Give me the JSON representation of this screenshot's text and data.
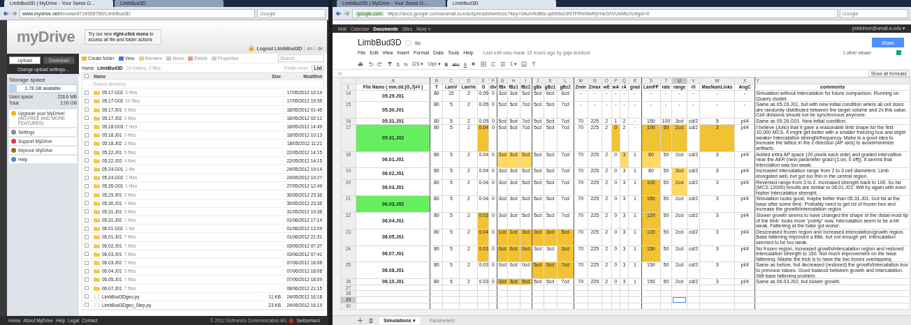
{
  "left_browser": {
    "tabs": [
      {
        "label": "LimbBud3D | MyDrive - Your Swiss O...",
        "selected": true
      },
      {
        "label": "LimbBud3D",
        "selected": false
      }
    ],
    "domain": "www.mydrive.net",
    "address": "/browse#714565780/LimbBud3D",
    "search_placeholder": "Google"
  },
  "mydrive": {
    "logo": "myDrive",
    "promo": "Try our new **right-click menu** to access all file and folder actions",
    "logout": "Logout LimbBud3D",
    "languages": [
      "en",
      "de"
    ],
    "upload": {
      "label": "Upload",
      "disabled": false
    },
    "download": {
      "label": "Download",
      "disabled": true
    },
    "upload_settings": "Change upload settings...",
    "storage": {
      "title": "Storage space",
      "available": "1.78 GB available",
      "level": 0.11,
      "used_label": "Used space",
      "used": "226.6 MB",
      "total_label": "Total",
      "total": "2.00 GB"
    },
    "menu": [
      {
        "kind": "upgrade",
        "label": "Upgrade your MyDrive!",
        "sub": "(AD-FREE AND MORE FEATURES)"
      },
      {
        "kind": "settings",
        "label": "Settings"
      },
      {
        "kind": "support",
        "label": "Support MyDrive"
      },
      {
        "kind": "improve",
        "label": "Improve MyDrive"
      },
      {
        "kind": "help",
        "label": "Help"
      }
    ],
    "toolbar": [
      {
        "kind": "create",
        "label": "Create folder",
        "disabled": false
      },
      {
        "kind": "view",
        "label": "View",
        "disabled": false
      },
      {
        "kind": "rename",
        "label": "Rename",
        "disabled": true
      },
      {
        "kind": "move",
        "label": "Move",
        "disabled": true
      },
      {
        "kind": "delete",
        "label": "Delete",
        "disabled": true
      },
      {
        "kind": "properties",
        "label": "Properties",
        "disabled": true
      }
    ],
    "search_placeholder": "Search...",
    "breadcrumb": {
      "home": "Home",
      "folder": "LimbBud3D",
      "summary": "24 folders, 2 files",
      "view_label": "Folder view:",
      "view": "List"
    },
    "columns": {
      "name": "Name",
      "size": "Size",
      "modified": "Modified"
    },
    "select_all": {
      "checked": false
    },
    "parent": "Parent directory",
    "items": [
      {
        "kind": "folder",
        "name": "05.17.G01",
        "count": "3 files",
        "modified": "17/05/2012 19:14",
        "checked": false
      },
      {
        "kind": "folder",
        "name": "05.17.G02",
        "count": "10 files",
        "modified": "17/05/2012 19:35",
        "checked": false
      },
      {
        "kind": "folder",
        "name": "05.17.J01",
        "count": "5 files",
        "modified": "18/05/2012 01:45",
        "checked": false
      },
      {
        "kind": "folder",
        "name": "05.17.J02",
        "count": "3 files",
        "modified": "18/05/2012 02:12",
        "checked": false
      },
      {
        "kind": "folder",
        "name": "05.18.G03",
        "count": "2 files",
        "modified": "18/05/2012 14:49",
        "checked": false
      },
      {
        "kind": "folder",
        "name": "05.18.J01",
        "count": "3 files",
        "modified": "18/05/2012 10:13",
        "checked": false
      },
      {
        "kind": "folder",
        "name": "05.18.J02",
        "count": "3 files",
        "modified": "18/05/2012 11:21",
        "checked": false
      },
      {
        "kind": "folder",
        "name": "05.22.J01",
        "count": "5 files",
        "modified": "22/05/2012 14:15",
        "checked": false
      },
      {
        "kind": "folder",
        "name": "05.22.J02",
        "count": "4 files",
        "modified": "22/05/2012 14:15",
        "checked": false
      },
      {
        "kind": "folder",
        "name": "05.24.G01",
        "count": "1 file",
        "modified": "24/05/2012 19:14",
        "checked": false
      },
      {
        "kind": "folder",
        "name": "05.24.G02",
        "count": "2 files",
        "modified": "24/05/2012 19:27",
        "checked": false
      },
      {
        "kind": "folder",
        "name": "05.26.G01",
        "count": "1 files",
        "modified": "27/05/2012 12:49",
        "checked": false
      },
      {
        "kind": "folder",
        "name": "05.29.J01",
        "count": "2 files",
        "modified": "30/05/2012 23:36",
        "checked": false
      },
      {
        "kind": "folder",
        "name": "05.30.J01",
        "count": "7 files",
        "modified": "30/05/2012 23:35",
        "checked": false
      },
      {
        "kind": "folder",
        "name": "05.31.J01",
        "count": "9 files",
        "modified": "31/05/2012 19:38",
        "checked": false
      },
      {
        "kind": "folder",
        "name": "05.31.J02",
        "count": "7 files",
        "modified": "01/06/2012 17:14",
        "checked": false
      },
      {
        "kind": "folder",
        "name": "06.01.G01",
        "count": "1 file",
        "modified": "01/06/2012 13:09",
        "checked": false
      },
      {
        "kind": "folder",
        "name": "06.01.J01",
        "count": "7 files",
        "modified": "01/06/2012 21:31",
        "checked": false
      },
      {
        "kind": "folder",
        "name": "06.02.J01",
        "count": "7 files",
        "modified": "03/06/2012 07:37",
        "checked": false
      },
      {
        "kind": "folder",
        "name": "06.03.J01",
        "count": "7 files",
        "modified": "03/06/2012 07:41",
        "checked": false
      },
      {
        "kind": "folder",
        "name": "06.03.J02",
        "count": "7 files",
        "modified": "07/06/2012 18:08",
        "checked": false
      },
      {
        "kind": "folder",
        "name": "06.04.J01",
        "count": "3 files",
        "modified": "07/06/2012 18:08",
        "checked": false
      },
      {
        "kind": "folder",
        "name": "06.05.J01",
        "count": "7 files",
        "modified": "07/06/2012 18:09",
        "checked": false
      },
      {
        "kind": "folder",
        "name": "06.07.J01",
        "count": "7 files",
        "modified": "08/06/2012 21:15",
        "checked": false
      },
      {
        "kind": "file",
        "name": "LimbBud3Dgeo.py",
        "size": "11 KB",
        "modified": "24/05/2012 16:18",
        "checked": false
      },
      {
        "kind": "file",
        "name": "LimbBud3Dgeo_Step.py",
        "size": "23 KB",
        "modified": "24/05/2012 16:19",
        "checked": false
      }
    ],
    "footer_links": [
      "Home",
      "About MyDrive",
      "Help",
      "Legal",
      "Contact"
    ],
    "copyright": "© 2012 Softronics Communication AG",
    "country": "Switzerland"
  },
  "right_browser": {
    "tabs": [
      {
        "label": "LimbBud3D | MyDrive - Your Swiss O...",
        "selected": false
      },
      {
        "label": "LimbBud3D",
        "selected": true
      }
    ],
    "domain": "google.com",
    "address": "https://docs.google.com/a/umail.iu.edu/spreadsheet/ccc?key=0AoiVkdBts-qd0Ma2dNTFRN0lwRjVneGhVUkMtcXc#gid=0",
    "search_placeholder": "Google"
  },
  "google_bar": {
    "links": [
      {
        "label": "Mail",
        "selected": false
      },
      {
        "label": "Calendar",
        "selected": false
      },
      {
        "label": "Documents",
        "selected": true
      },
      {
        "label": "Sites",
        "selected": false
      },
      {
        "label": "More »",
        "selected": false
      }
    ],
    "user": "jmbelmon@umail.iu.edu ▾"
  },
  "document": {
    "title": "LimbBud3D",
    "share": "Share",
    "menu": [
      "File",
      "Edit",
      "View",
      "Insert",
      "Format",
      "Data",
      "Tools",
      "Help"
    ],
    "last_edit": "Last edit was made 15 hours ago by gaja lesnicar",
    "viewers": "1 other viewer",
    "toolbar": {
      "currency": "$",
      "percent": "%",
      "number_format": "123 ▾",
      "font_size": "10pt ▾",
      "bold": "B",
      "strike": "abc",
      "text_color": "A",
      "sum": "Σ ▾"
    },
    "fx": "fx",
    "show_formulas": "Show all formulas"
  },
  "sheet": {
    "header_row": "1",
    "columns": [
      {
        "letter": "A",
        "name": "File Name ( mm.dd.(G,J)## )",
        "selected": false
      },
      {
        "letter": "B",
        "name": "T",
        "selected": false
      },
      {
        "letter": "C",
        "name": "LamV",
        "selected": false
      },
      {
        "letter": "D",
        "name": "LamVe",
        "selected": false
      },
      {
        "letter": "E",
        "name": "G",
        "selected": false
      },
      {
        "letter": "F",
        "name": "div",
        "selected": false
      },
      {
        "letter": "G",
        "name": "fBx",
        "selected": false
      },
      {
        "letter": "H",
        "name": "fBz1",
        "selected": false
      },
      {
        "letter": "I",
        "name": "fBz2",
        "selected": false
      },
      {
        "letter": "J",
        "name": "gBx",
        "selected": false
      },
      {
        "letter": "K",
        "name": "gBz1",
        "selected": false
      },
      {
        "letter": "L",
        "name": "gBz2",
        "selected": false
      },
      {
        "letter": "M",
        "name": "Zmin",
        "selected": false
      },
      {
        "letter": "N",
        "name": "Zmax",
        "selected": false
      },
      {
        "letter": "O",
        "name": "wE",
        "selected": false
      },
      {
        "letter": "P",
        "name": "wA",
        "selected": false
      },
      {
        "letter": "Q",
        "name": "rA",
        "selected": false
      },
      {
        "letter": "R",
        "name": "grad",
        "selected": false
      },
      {
        "letter": "S",
        "name": "LamFP",
        "selected": false
      },
      {
        "letter": "T",
        "name": "rate",
        "selected": false
      },
      {
        "letter": "U",
        "name": "range",
        "selected": true
      },
      {
        "letter": "V",
        "name": "r0",
        "selected": false
      },
      {
        "letter": "W",
        "name": "MaxNumLinks",
        "selected": false
      },
      {
        "letter": "X",
        "name": "AngC",
        "selected": false
      },
      {
        "letter": "Y",
        "name": "comments",
        "selected": false
      }
    ],
    "rows": [
      {
        "number": "14",
        "selected": false,
        "cells": [
          {
            "text": "05.29.J01"
          },
          {
            "text": "80"
          },
          {
            "text": "15"
          },
          {
            "text": "2"
          },
          {
            "text": "0.05"
          },
          {
            "text": "0"
          },
          {
            "text": "3cd"
          },
          {
            "text": "3cd"
          },
          {
            "text": "5cd"
          },
          {
            "text": "5cd"
          },
          {
            "text": "6cd"
          },
          {
            "text": "6cd"
          },
          {
            "text": "-"
          },
          {
            "text": "-"
          },
          {
            "text": "-"
          },
          {
            "text": "-"
          },
          {
            "text": "-"
          },
          {
            "text": "-"
          },
          {
            "text": "-"
          },
          {
            "text": "-"
          },
          {
            "text": "-"
          },
          {
            "text": "-"
          },
          {
            "text": "-"
          },
          {
            "text": "-"
          },
          {
            "text": "Simulation without intercalation for future comparison. Running on Quarry cluster."
          }
        ]
      },
      {
        "number": "15",
        "selected": false,
        "cells": [
          {
            "text": "05.30.J01"
          },
          {
            "text": "80"
          },
          {
            "text": "5"
          },
          {
            "text": "2"
          },
          {
            "text": "0.05"
          },
          {
            "text": "0"
          },
          {
            "text": "5cd"
          },
          {
            "text": "5cd"
          },
          {
            "text": "7cd"
          },
          {
            "text": "5cd"
          },
          {
            "text": "5cd"
          },
          {
            "text": "7cd"
          },
          {
            "text": "-"
          },
          {
            "text": "-"
          },
          {
            "text": "-"
          },
          {
            "text": "-"
          },
          {
            "text": "-"
          },
          {
            "text": "-"
          },
          {
            "text": "-"
          },
          {
            "text": "-"
          },
          {
            "text": "-"
          },
          {
            "text": "-"
          },
          {
            "text": "-"
          },
          {
            "text": "-"
          },
          {
            "text": "Same as 05.29.J01, but with new initial condition where all cell sizes are randomly distributed between the target volume and 2x this value. Cell divisions should not be synchronous anymore."
          }
        ]
      },
      {
        "number": "16",
        "selected": false,
        "cells": [
          {
            "text": "05.31.J01"
          },
          {
            "text": "80"
          },
          {
            "text": "5"
          },
          {
            "text": "2"
          },
          {
            "text": "0.05"
          },
          {
            "text": "0"
          },
          {
            "text": "5cd"
          },
          {
            "text": "5cd"
          },
          {
            "text": "7cd"
          },
          {
            "text": "5cd"
          },
          {
            "text": "5cd"
          },
          {
            "text": "7cd"
          },
          {
            "text": "70"
          },
          {
            "text": "225"
          },
          {
            "text": "2"
          },
          {
            "text": "1"
          },
          {
            "text": "2"
          },
          {
            "text": "-"
          },
          {
            "text": "150"
          },
          {
            "text": "100"
          },
          {
            "text": "3cd"
          },
          {
            "text": "cd/2"
          },
          {
            "text": "5"
          },
          {
            "text": "pi/4"
          },
          {
            "text": "Same as 05.26.G01. New initial condition."
          }
        ]
      },
      {
        "number": "17",
        "selected": false,
        "cells": [
          {
            "text": "05.31.J02",
            "color": "#66ee5e"
          },
          {
            "text": "80"
          },
          {
            "text": "5"
          },
          {
            "text": "2"
          },
          {
            "text": "0.04",
            "color": "#f1c232"
          },
          {
            "text": "0"
          },
          {
            "text": "5cd"
          },
          {
            "text": "5cd"
          },
          {
            "text": "7cd"
          },
          {
            "text": "5cd"
          },
          {
            "text": "5cd"
          },
          {
            "text": "7cd"
          },
          {
            "text": "70"
          },
          {
            "text": "225"
          },
          {
            "text": "2"
          },
          {
            "text": "0",
            "color": "#f1c232"
          },
          {
            "text": "2"
          },
          {
            "text": "-"
          },
          {
            "text": "100",
            "color": "#f1c232"
          },
          {
            "text": "50",
            "color": "#f1c232"
          },
          {
            "text": "2cd",
            "color": "#f1c232"
          },
          {
            "text": "cd/2"
          },
          {
            "text": "3",
            "color": "#f1c232"
          },
          {
            "text": "pi/4"
          },
          {
            "text": "I believe (Julio) that it gave a reasonable limb shape for the first 10,000 MCS. It might get better with a smaller freezing box and slight weaker intercalation strenght/frequency. Mabe is a good idea to increase the lattice in the z direction (AP axis) to avoid/minimize artifacts."
          }
        ]
      },
      {
        "number": "18",
        "selected": false,
        "cells": [
          {
            "text": "06.01.J01"
          },
          {
            "text": "80"
          },
          {
            "text": "5"
          },
          {
            "text": "2"
          },
          {
            "text": "0.04"
          },
          {
            "text": "0"
          },
          {
            "text": "3cd",
            "color": "#ffd966"
          },
          {
            "text": "3cd",
            "color": "#ffd966"
          },
          {
            "text": "5cd",
            "color": "#ffd966"
          },
          {
            "text": "5cd"
          },
          {
            "text": "5cd"
          },
          {
            "text": "7cd"
          },
          {
            "text": "70"
          },
          {
            "text": "225"
          },
          {
            "text": "2"
          },
          {
            "text": "0"
          },
          {
            "text": "3",
            "color": "#ffd966"
          },
          {
            "text": "1"
          },
          {
            "text": "80",
            "color": "#ffd966"
          },
          {
            "text": "50"
          },
          {
            "text": "2cd"
          },
          {
            "text": "cd/2"
          },
          {
            "text": "3"
          },
          {
            "text": "pi/4"
          },
          {
            "text": "Added extra AP space (20 pixels each side) and graded intercaltion near the AER (new parameter grad={1:on, 0 off}). It seems that interclation was too weak."
          }
        ]
      },
      {
        "number": "19",
        "selected": false,
        "cells": [
          {
            "text": "06.02.J01"
          },
          {
            "text": "80"
          },
          {
            "text": "5"
          },
          {
            "text": "2"
          },
          {
            "text": "0.04"
          },
          {
            "text": "0"
          },
          {
            "text": "3cd"
          },
          {
            "text": "3cd"
          },
          {
            "text": "5cd"
          },
          {
            "text": "5cd"
          },
          {
            "text": "5cd"
          },
          {
            "text": "7cd"
          },
          {
            "text": "70"
          },
          {
            "text": "225"
          },
          {
            "text": "2"
          },
          {
            "text": "0"
          },
          {
            "text": "3"
          },
          {
            "text": "1"
          },
          {
            "text": "80"
          },
          {
            "text": "50"
          },
          {
            "text": "3cd",
            "color": "#ffd966"
          },
          {
            "text": "cd/2"
          },
          {
            "text": "3"
          },
          {
            "text": "pi/4"
          },
          {
            "text": "Increased intercalation range from 2 to 3 cell diameters. Limb elongated well, but got too thin in the central region."
          }
        ]
      },
      {
        "number": "20",
        "selected": false,
        "cells": [
          {
            "text": "06.03.J01"
          },
          {
            "text": "80"
          },
          {
            "text": "5"
          },
          {
            "text": "2"
          },
          {
            "text": "0.04"
          },
          {
            "text": "0"
          },
          {
            "text": "3cd"
          },
          {
            "text": "3cd"
          },
          {
            "text": "5cd"
          },
          {
            "text": "5cd"
          },
          {
            "text": "5cd"
          },
          {
            "text": "7cd"
          },
          {
            "text": "70"
          },
          {
            "text": "225"
          },
          {
            "text": "2"
          },
          {
            "text": "0"
          },
          {
            "text": "3"
          },
          {
            "text": "1"
          },
          {
            "text": "100",
            "color": "#f1c232"
          },
          {
            "text": "50"
          },
          {
            "text": "2cd",
            "color": "#ffd966"
          },
          {
            "text": "cd/2"
          },
          {
            "text": "3"
          },
          {
            "text": "pi/4"
          },
          {
            "text": "Reversed range from 3 to 2. Increased strength back to 100. So far (MCS 12000) results are similar to 06.01.J01. Will try again with even higher intercalation strenght."
          }
        ]
      },
      {
        "number": "21",
        "selected": false,
        "cells": [
          {
            "text": "06.03.J02",
            "color": "#66ee5e"
          },
          {
            "text": "80"
          },
          {
            "text": "5"
          },
          {
            "text": "2"
          },
          {
            "text": "0.04"
          },
          {
            "text": "0"
          },
          {
            "text": "3cd"
          },
          {
            "text": "3cd"
          },
          {
            "text": "5cd"
          },
          {
            "text": "5cd"
          },
          {
            "text": "5cd"
          },
          {
            "text": "7cd"
          },
          {
            "text": "70"
          },
          {
            "text": "225"
          },
          {
            "text": "2"
          },
          {
            "text": "0"
          },
          {
            "text": "3"
          },
          {
            "text": "1"
          },
          {
            "text": "150",
            "color": "#f1c232"
          },
          {
            "text": "50"
          },
          {
            "text": "2cd"
          },
          {
            "text": "cd/2"
          },
          {
            "text": "3"
          },
          {
            "text": "pi/4"
          },
          {
            "text": "Simulation looks good, maybe better than 05.31.J01. Got fat at the base after some time. Probably need to get rid of frozen box and increase the growth/intercalation region."
          }
        ]
      },
      {
        "number": "22",
        "selected": false,
        "cells": [
          {
            "text": "06.04.J01"
          },
          {
            "text": "80"
          },
          {
            "text": "5"
          },
          {
            "text": "2"
          },
          {
            "text": "0.03",
            "color": "#f1c232"
          },
          {
            "text": "0"
          },
          {
            "text": "3cd"
          },
          {
            "text": "3cd"
          },
          {
            "text": "5cd"
          },
          {
            "text": "5cd"
          },
          {
            "text": "5cd"
          },
          {
            "text": "7cd"
          },
          {
            "text": "70"
          },
          {
            "text": "225"
          },
          {
            "text": "2"
          },
          {
            "text": "0"
          },
          {
            "text": "3"
          },
          {
            "text": "1"
          },
          {
            "text": "120",
            "color": "#f1c232"
          },
          {
            "text": "50"
          },
          {
            "text": "2cd"
          },
          {
            "text": "cd/2"
          },
          {
            "text": "3"
          },
          {
            "text": "pi/4"
          },
          {
            "text": "Slower growth seems to have changed the shape of the distal-most tip of the limb: looks more \"pointy\" now. Intercalation seem to be a bit weak. Fattening at the base got worse."
          }
        ]
      },
      {
        "number": "23",
        "selected": false,
        "cells": [
          {
            "text": "06.05.J01"
          },
          {
            "text": "80"
          },
          {
            "text": "5"
          },
          {
            "text": "2"
          },
          {
            "text": "0.04",
            "color": "#f1c232"
          },
          {
            "text": "0"
          },
          {
            "text": "1cd",
            "color": "#f1c232"
          },
          {
            "text": "1cd",
            "color": "#f1c232"
          },
          {
            "text": "3cd",
            "color": "#f1c232"
          },
          {
            "text": "3cd",
            "color": "#f1c232"
          },
          {
            "text": "3cd",
            "color": "#f1c232"
          },
          {
            "text": "5cd",
            "color": "#f1c232"
          },
          {
            "text": "70"
          },
          {
            "text": "225"
          },
          {
            "text": "2"
          },
          {
            "text": "0"
          },
          {
            "text": "3"
          },
          {
            "text": "1"
          },
          {
            "text": "120",
            "color": "#f1c232"
          },
          {
            "text": "50"
          },
          {
            "text": "2cd"
          },
          {
            "text": "cd/2"
          },
          {
            "text": "3"
          },
          {
            "text": "pi/4"
          },
          {
            "text": "Descreased frozen region and increased intercalation/growth region. Base fattening improved a little, but not enough yet. Intercalation seemed to be too weak."
          }
        ]
      },
      {
        "number": "24",
        "selected": false,
        "cells": [
          {
            "text": "06.07.J01"
          },
          {
            "text": "80"
          },
          {
            "text": "5"
          },
          {
            "text": "2"
          },
          {
            "text": "0.03",
            "color": "#f1c232"
          },
          {
            "text": "0"
          },
          {
            "text": "0cd",
            "color": "#f1c232"
          },
          {
            "text": "0cd",
            "color": "#f1c232"
          },
          {
            "text": "0cd",
            "color": "#f1c232"
          },
          {
            "text": "3cd"
          },
          {
            "text": "3cd"
          },
          {
            "text": "3cd",
            "color": "#f1c232"
          },
          {
            "text": "70"
          },
          {
            "text": "225"
          },
          {
            "text": "2"
          },
          {
            "text": "0"
          },
          {
            "text": "3"
          },
          {
            "text": "1"
          },
          {
            "text": "150",
            "color": "#f1c232"
          },
          {
            "text": "50"
          },
          {
            "text": "2cd"
          },
          {
            "text": "cd/2"
          },
          {
            "text": "3"
          },
          {
            "text": "pi/4"
          },
          {
            "text": "No frozen region, increased growth/intercalation region and restored intercalation strength to 150. Not much improvement on the base fattening. Maybe the trick is to have the two boxes overlapping."
          }
        ]
      },
      {
        "number": "25",
        "selected": false,
        "cells": [
          {
            "text": "06.08.J01"
          },
          {
            "text": "80"
          },
          {
            "text": "5"
          },
          {
            "text": "2"
          },
          {
            "text": "0.03"
          },
          {
            "text": "0"
          },
          {
            "text": "0cd"
          },
          {
            "text": "0cd"
          },
          {
            "text": "0cd"
          },
          {
            "text": "5cd",
            "color": "#f1c232"
          },
          {
            "text": "5cd",
            "color": "#f1c232"
          },
          {
            "text": "7cd",
            "color": "#f1c232"
          },
          {
            "text": "70"
          },
          {
            "text": "225"
          },
          {
            "text": "2"
          },
          {
            "text": "0"
          },
          {
            "text": "3"
          },
          {
            "text": "1"
          },
          {
            "text": "150"
          },
          {
            "text": "50"
          },
          {
            "text": "2cd"
          },
          {
            "text": "cd/2"
          },
          {
            "text": "3"
          },
          {
            "text": "pi/4"
          },
          {
            "text": "Same as before, but decreased (restored) the growth/intercalation box to previous values. Good balance between growth and intercalation. Still base fattening problem."
          }
        ]
      },
      {
        "number": "26",
        "selected": false,
        "cells": [
          {
            "text": "06.10.J01"
          },
          {
            "text": "80"
          },
          {
            "text": "5"
          },
          {
            "text": "2"
          },
          {
            "text": "0.03"
          },
          {
            "text": "0"
          },
          {
            "text": "3cd",
            "color": "#f1c232"
          },
          {
            "text": "3cd",
            "color": "#f1c232"
          },
          {
            "text": "5cd",
            "color": "#f1c232"
          },
          {
            "text": "5cd"
          },
          {
            "text": "5cd"
          },
          {
            "text": "7cd"
          },
          {
            "text": "70"
          },
          {
            "text": "225"
          },
          {
            "text": "2"
          },
          {
            "text": "0"
          },
          {
            "text": "3"
          },
          {
            "text": "1"
          },
          {
            "text": "150"
          },
          {
            "text": "50"
          },
          {
            "text": "2cd"
          },
          {
            "text": "cd/2"
          },
          {
            "text": "3"
          },
          {
            "text": "pi/4"
          },
          {
            "text": "Same as 06.03.J02, but slower growth."
          }
        ]
      },
      {
        "number": "27",
        "selected": false
      },
      {
        "number": "28",
        "selected": false
      },
      {
        "number": "29",
        "selected": true
      },
      {
        "number": "30",
        "selected": false
      }
    ],
    "sheet_tabs": [
      {
        "label": "Simulations ▾",
        "selected": true
      },
      {
        "label": "Parameters",
        "selected": false
      }
    ]
  }
}
